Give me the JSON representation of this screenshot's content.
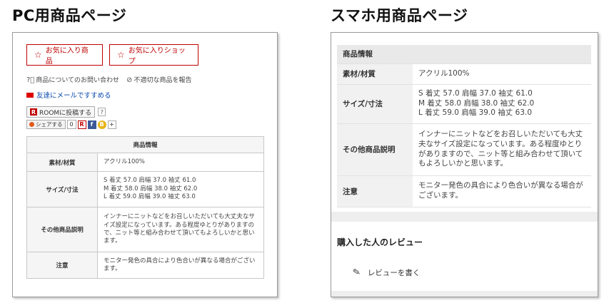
{
  "headings": {
    "pc": "PC用商品ページ",
    "sp": "スマホ用商品ページ"
  },
  "pc": {
    "fav_item_label": "お気に入り商品",
    "fav_shop_label": "お気に入りショップ",
    "inquiry_label": "商品についてのお問い合わせ",
    "report_label": "不適切な商品を報告",
    "mail_label": "友達にメールですすめる",
    "room_label": "ROOMに投稿する",
    "room_logo": "R",
    "help_label": "?",
    "share_label": "シェアする",
    "share_count": "0",
    "share_icons": [
      "R",
      "f",
      "B",
      "+"
    ],
    "table": {
      "caption": "商品情報",
      "rows": [
        {
          "key": "素材/材質",
          "value": [
            "アクリル100%"
          ]
        },
        {
          "key": "サイズ/寸法",
          "value": [
            "S 着丈 57.0 肩幅 37.0 袖丈 61.0",
            "M 着丈 58.0 肩幅 38.0 袖丈 62.0",
            "L 着丈 59.0 肩幅 39.0 袖丈 63.0"
          ]
        },
        {
          "key": "その他商品説明",
          "value": [
            "インナーにニットなどをお召しいただいても大丈夫なサイズ設定になっています。ある程度ゆとりがありますので、ニット等と組み合わせて頂いてもよろしいかと思います。"
          ]
        },
        {
          "key": "注意",
          "value": [
            "モニター発色の具合により色合いが異なる場合がございます。"
          ]
        }
      ]
    }
  },
  "sp": {
    "table": {
      "caption": "商品情報",
      "rows": [
        {
          "key": "素材/材質",
          "value": [
            "アクリル100%"
          ]
        },
        {
          "key": "サイズ/寸法",
          "value": [
            "S 着丈 57.0 肩幅 37.0 袖丈 61.0",
            "M 着丈 58.0 肩幅 38.0 袖丈 62.0",
            "L 着丈 59.0 肩幅 39.0 袖丈 63.0"
          ]
        },
        {
          "key": "その他商品説明",
          "value": [
            "インナーにニットなどをお召しいただいても大丈夫なサイズ設定になっています。ある程度ゆとりがありますので、ニット等と組み合わせて頂いてもよろしいかと思います。"
          ]
        },
        {
          "key": "注意",
          "value": [
            "モニター発色の具合により色合いが異なる場合がございます。"
          ]
        }
      ]
    },
    "review_title": "購入した人のレビュー",
    "review_write_label": "レビューを書く"
  },
  "colors": {
    "accent_red": "#bf0000",
    "link_blue": "#0645ad",
    "table_header_bg": "#f5f5f5"
  },
  "icons": {
    "star": "star-icon",
    "question": "question-circle-icon",
    "prohibit": "prohibit-icon",
    "mail": "mail-icon",
    "pencil": "pencil-icon"
  }
}
